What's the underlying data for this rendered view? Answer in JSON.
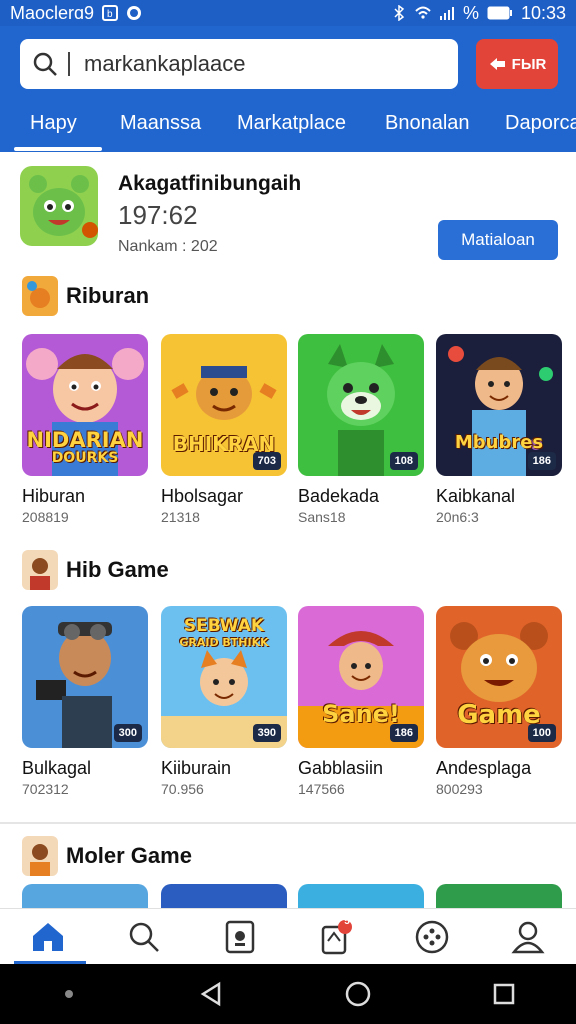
{
  "status_bar": {
    "carrier": "Maocler",
    "carrier_suffix": "ɑ9",
    "battery_text": "%",
    "time": "10:33"
  },
  "search": {
    "value": "markankaplaace"
  },
  "header_button": {
    "label": "FЫR",
    "icon": "arrow-icon"
  },
  "tabs": [
    {
      "label": "Hapy",
      "active": true
    },
    {
      "label": "Maanssa"
    },
    {
      "label": "Markatplace"
    },
    {
      "label": "Bnonalan"
    },
    {
      "label": "Daporca"
    }
  ],
  "featured": {
    "title": "Akagatfinibungaih",
    "number": "197:62",
    "subtitle": "Nankam : 202",
    "button_label": "Matialoan"
  },
  "sections": [
    {
      "title": "Riburan",
      "cards": [
        {
          "name": "Hiburan",
          "count": "208819",
          "tile_text": "NIDARIAN",
          "tile_text2": "DOURKS",
          "badge": ""
        },
        {
          "name": "Hbolsagar",
          "count": "21318",
          "tile_text": "BHIKRAN",
          "tile_text2": "",
          "badge": "703"
        },
        {
          "name": "Badekada",
          "count": "Sans18",
          "tile_text": "",
          "tile_text2": "",
          "badge": "108"
        },
        {
          "name": "Kaibkanal",
          "count": "20n6:3",
          "tile_text": "Mbubres",
          "tile_text2": "",
          "badge": "186"
        }
      ]
    },
    {
      "title": "Hib Game",
      "cards": [
        {
          "name": "Bulkagal",
          "count": "702312",
          "tile_text": "",
          "tile_text2": "",
          "badge": "300"
        },
        {
          "name": "Kiiburain",
          "count": "70.956",
          "tile_text": "SEBWAK",
          "tile_text2": "GRAID BTHIKK",
          "badge": "390"
        },
        {
          "name": "Gabblasiin",
          "count": "147566",
          "tile_text": "Sane!",
          "tile_text2": "",
          "badge": "186"
        },
        {
          "name": "Andesplaga",
          "count": "800293",
          "tile_text": "Game",
          "tile_text2": "",
          "badge": "100"
        }
      ]
    },
    {
      "title": "Moler Game",
      "cards": []
    }
  ],
  "bottom_nav": [
    {
      "name": "home",
      "icon": "home-icon",
      "active": true
    },
    {
      "name": "search",
      "icon": "search-icon"
    },
    {
      "name": "library",
      "icon": "document-icon"
    },
    {
      "name": "notifications",
      "icon": "badge-icon",
      "badge": "5"
    },
    {
      "name": "games",
      "icon": "controller-icon"
    },
    {
      "name": "profile",
      "icon": "person-icon"
    }
  ],
  "colors": {
    "primary": "#2166cf",
    "accent": "#e2443a"
  }
}
